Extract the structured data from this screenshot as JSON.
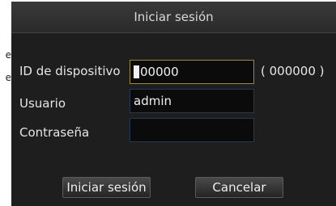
{
  "background_fragments": [
    "e",
    "e"
  ],
  "dialog": {
    "title": "Iniciar sesión",
    "fields": {
      "device_id": {
        "label": "ID de dispositivo",
        "value": "00000",
        "hint": "( 000000 )"
      },
      "user": {
        "label": "Usuario",
        "value": "admin"
      },
      "password": {
        "label": "Contraseña",
        "value": ""
      }
    },
    "buttons": {
      "login": "Iniciar sesión",
      "cancel": "Cancelar"
    }
  },
  "colors": {
    "dialog_background": "#1e1e1e",
    "focused_field_border": "#9a8a3a",
    "field_border": "#223a52"
  }
}
